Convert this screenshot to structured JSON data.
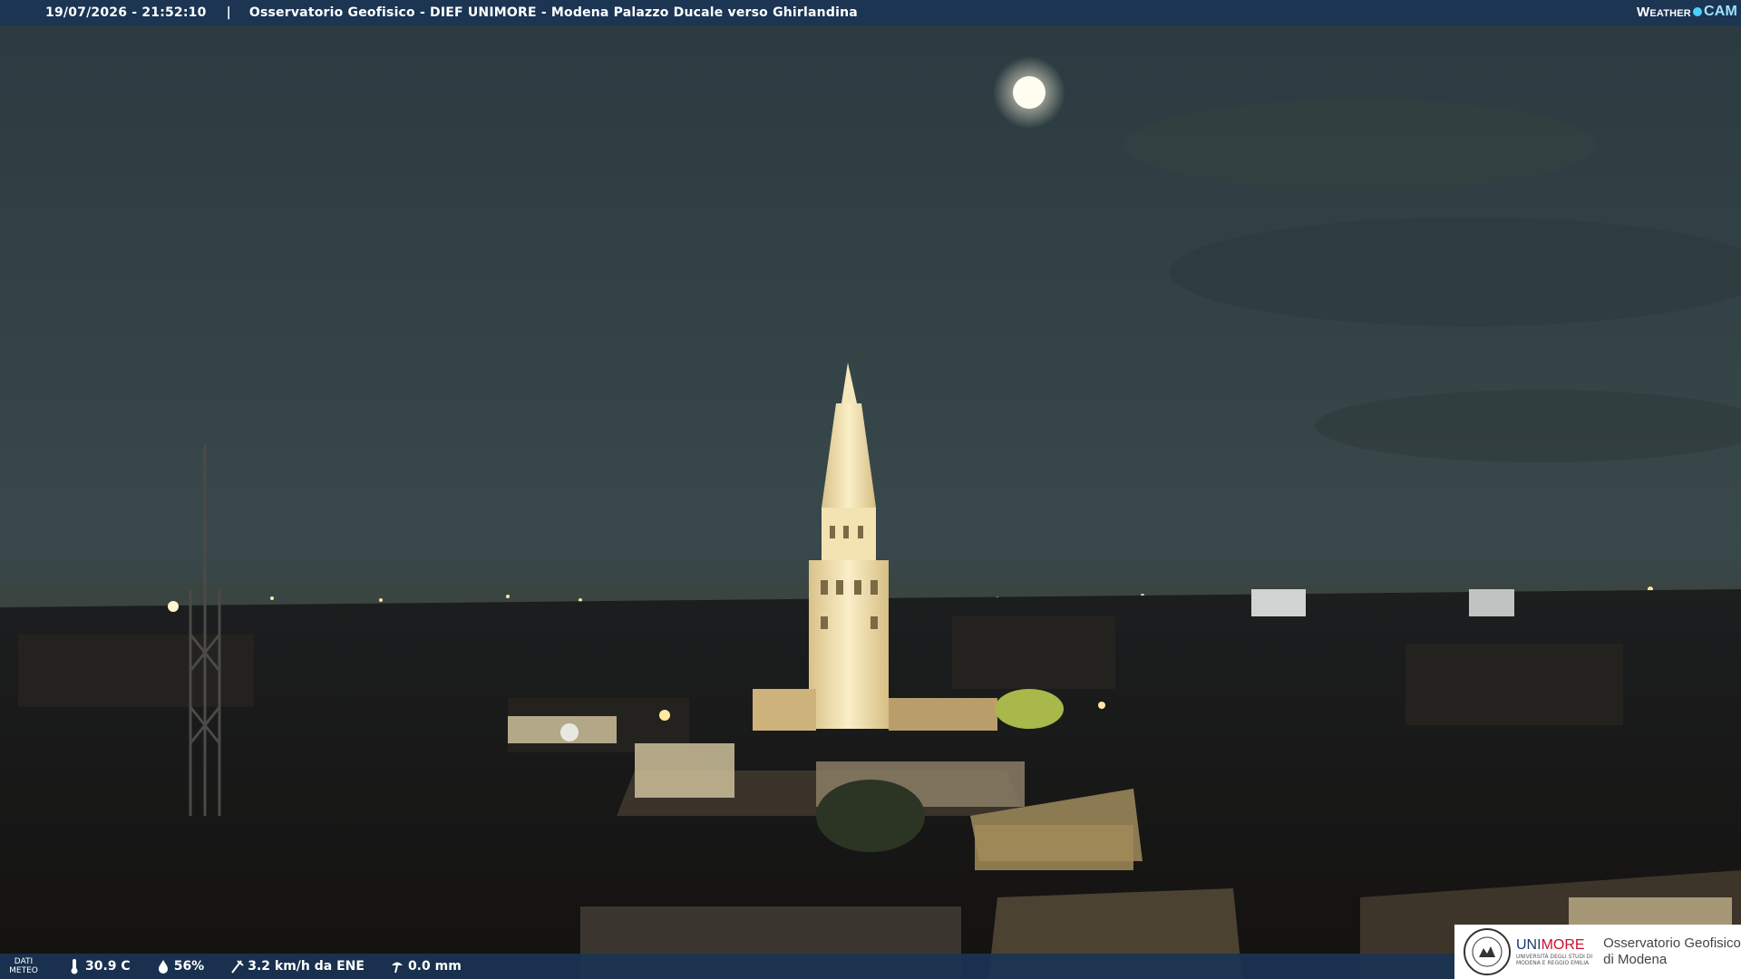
{
  "header": {
    "timestamp": "19/07/2026 - 21:52:10",
    "separator": "|",
    "title": "Osservatorio Geofisico - DIEF UNIMORE - Modena Palazzo Ducale verso Ghirlandina"
  },
  "brand": {
    "part1": "Weather",
    "part2": "CAM"
  },
  "footer": {
    "tag_line1": "DATI",
    "tag_line2": "METEO",
    "temperature": "30.9 C",
    "humidity": "56%",
    "wind": "3.2 km/h da ENE",
    "rain": "0.0 mm",
    "icons": [
      "thermometer-icon",
      "humidity-drop-icon",
      "wind-icon",
      "rain-gauge-icon"
    ]
  },
  "logo": {
    "uni_part1": "UNI",
    "uni_part2": "MORE",
    "uni_sub1": "UNIVERSITÀ DEGLI STUDI DI",
    "uni_sub2": "MODENA E REGGIO EMILIA",
    "obs_line1": "Osservatorio Geofisico",
    "obs_line2": "di Modena"
  },
  "colors": {
    "bar": "#1b3553",
    "sky": "#3a4a4c",
    "tower_light": "#f4e2b0",
    "unimore_blue": "#1a3a6b",
    "unimore_red": "#c8102e"
  }
}
